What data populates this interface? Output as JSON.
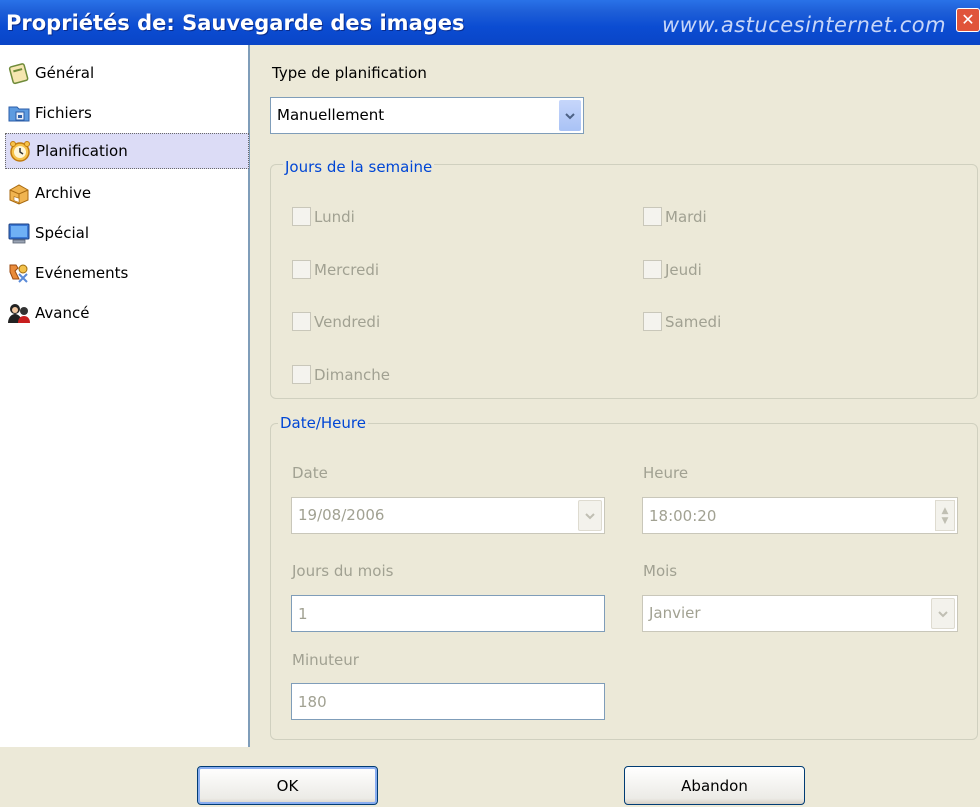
{
  "window": {
    "title": "Propriétés de: Sauvegarde des images",
    "watermark": "www.astucesinternet.com",
    "close_glyph": "✕"
  },
  "sidebar": {
    "items": [
      {
        "label": "Général",
        "icon": "general-icon",
        "selected": false
      },
      {
        "label": "Fichiers",
        "icon": "files-icon",
        "selected": false
      },
      {
        "label": "Planification",
        "icon": "alarm-clock-icon",
        "selected": true
      },
      {
        "label": "Archive",
        "icon": "archive-box-icon",
        "selected": false
      },
      {
        "label": "Spécial",
        "icon": "monitor-icon",
        "selected": false
      },
      {
        "label": "Evénements",
        "icon": "events-icon",
        "selected": false
      },
      {
        "label": "Avancé",
        "icon": "advanced-users-icon",
        "selected": false
      }
    ]
  },
  "schedule": {
    "type_label": "Type de planification",
    "type_value": "Manuellement",
    "weekdays": {
      "legend": "Jours de la semaine",
      "days": [
        "Lundi",
        "Mardi",
        "Mercredi",
        "Jeudi",
        "Vendredi",
        "Samedi",
        "Dimanche"
      ]
    },
    "datetime": {
      "legend": "Date/Heure",
      "date_label": "Date",
      "date_value": "19/08/2006",
      "time_label": "Heure",
      "time_value": "18:00:20",
      "month_days_label": "Jours du mois",
      "month_days_value": "1",
      "month_label": "Mois",
      "month_value": "Janvier",
      "timer_label": "Minuteur",
      "timer_value": "180"
    }
  },
  "buttons": {
    "ok": "OK",
    "cancel": "Abandon"
  },
  "colors": {
    "titlebar": "#0b4cd2",
    "legend": "#0046d5",
    "disabled_text": "#a1a192",
    "window_bg": "#ece9d8"
  }
}
